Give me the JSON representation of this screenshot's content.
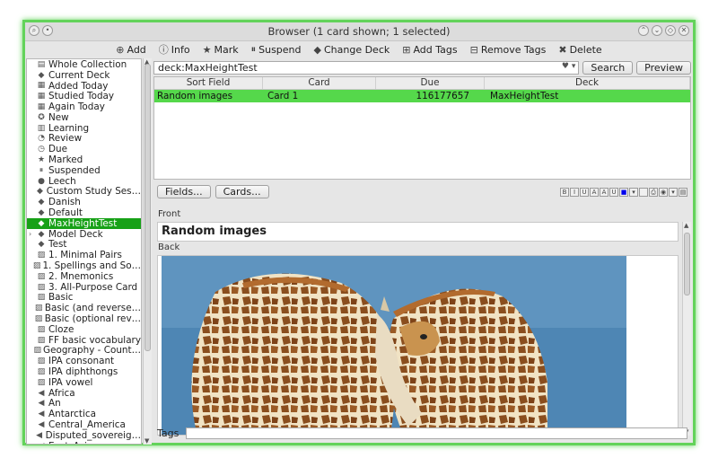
{
  "window": {
    "title": "Browser (1 card shown; 1 selected)"
  },
  "toolbar": [
    {
      "icon": "add-icon",
      "glyph": "⊕",
      "label": "Add"
    },
    {
      "icon": "info-icon",
      "glyph": "ⓘ",
      "label": "Info"
    },
    {
      "icon": "star-icon",
      "glyph": "★",
      "label": "Mark"
    },
    {
      "icon": "pause-icon",
      "glyph": "⏸",
      "label": "Suspend"
    },
    {
      "icon": "change-deck-icon",
      "glyph": "◆",
      "label": "Change Deck"
    },
    {
      "icon": "tag-icon",
      "glyph": "⊞",
      "label": "Add Tags"
    },
    {
      "icon": "remove-tag-icon",
      "glyph": "⊟",
      "label": "Remove Tags"
    },
    {
      "icon": "delete-icon",
      "glyph": "✖",
      "label": "Delete"
    }
  ],
  "sidebar": {
    "items": [
      {
        "label": "Whole Collection",
        "icon": "collection-icon",
        "glyph": "▤"
      },
      {
        "label": "Current Deck",
        "icon": "deck-icon",
        "glyph": "◆"
      },
      {
        "label": "Added Today",
        "icon": "calendar-icon",
        "glyph": "▦"
      },
      {
        "label": "Studied Today",
        "icon": "calendar-icon",
        "glyph": "▦"
      },
      {
        "label": "Again Today",
        "icon": "calendar-icon",
        "glyph": "▦"
      },
      {
        "label": "New",
        "icon": "new-icon",
        "glyph": "✪"
      },
      {
        "label": "Learning",
        "icon": "learning-icon",
        "glyph": "▥"
      },
      {
        "label": "Review",
        "icon": "review-icon",
        "glyph": "◔"
      },
      {
        "label": "Due",
        "icon": "clock-icon",
        "glyph": "◷"
      },
      {
        "label": "Marked",
        "icon": "star-icon",
        "glyph": "★"
      },
      {
        "label": "Suspended",
        "icon": "pause-icon",
        "glyph": "⏸"
      },
      {
        "label": "Leech",
        "icon": "leech-icon",
        "glyph": "●"
      },
      {
        "label": "Custom Study Ses…",
        "icon": "deck-icon",
        "glyph": "◆"
      },
      {
        "label": "Danish",
        "icon": "deck-icon",
        "glyph": "◆"
      },
      {
        "label": "Default",
        "icon": "deck-icon",
        "glyph": "◆"
      },
      {
        "label": "MaxHeightTest",
        "icon": "deck-icon",
        "glyph": "◆",
        "selected": true
      },
      {
        "label": "Model Deck",
        "icon": "deck-icon",
        "glyph": "◆",
        "expander": "›"
      },
      {
        "label": "Test",
        "icon": "deck-icon",
        "glyph": "◆"
      },
      {
        "label": "1. Minimal Pairs",
        "icon": "note-type-icon",
        "glyph": "▨"
      },
      {
        "label": "1. Spellings and So…",
        "icon": "note-type-icon",
        "glyph": "▨"
      },
      {
        "label": "2. Mnemonics",
        "icon": "note-type-icon",
        "glyph": "▨"
      },
      {
        "label": "3. All-Purpose Card",
        "icon": "note-type-icon",
        "glyph": "▨"
      },
      {
        "label": "Basic",
        "icon": "note-type-icon",
        "glyph": "▨"
      },
      {
        "label": "Basic (and reverse…",
        "icon": "note-type-icon",
        "glyph": "▨"
      },
      {
        "label": "Basic (optional rev…",
        "icon": "note-type-icon",
        "glyph": "▨"
      },
      {
        "label": "Cloze",
        "icon": "note-type-icon",
        "glyph": "▨"
      },
      {
        "label": "FF basic vocabulary",
        "icon": "note-type-icon",
        "glyph": "▨"
      },
      {
        "label": "Geography - Count…",
        "icon": "note-type-icon",
        "glyph": "▨"
      },
      {
        "label": "IPA consonant",
        "icon": "note-type-icon",
        "glyph": "▨"
      },
      {
        "label": "IPA diphthongs",
        "icon": "note-type-icon",
        "glyph": "▨"
      },
      {
        "label": "IPA vowel",
        "icon": "note-type-icon",
        "glyph": "▨"
      },
      {
        "label": "Africa",
        "icon": "tag-icon",
        "glyph": "◀"
      },
      {
        "label": "An",
        "icon": "tag-icon",
        "glyph": "◀"
      },
      {
        "label": "Antarctica",
        "icon": "tag-icon",
        "glyph": "◀"
      },
      {
        "label": "Central_America",
        "icon": "tag-icon",
        "glyph": "◀"
      },
      {
        "label": "Disputed_sovereig…",
        "icon": "tag-icon",
        "glyph": "◀"
      },
      {
        "label": "East_Asia",
        "icon": "tag-icon",
        "glyph": "◀"
      }
    ]
  },
  "search": {
    "value": "deck:MaxHeightTest",
    "search_label": "Search",
    "preview_label": "Preview"
  },
  "table": {
    "columns": [
      "Sort Field",
      "Card",
      "Due",
      "Deck"
    ],
    "rows": [
      [
        "Random images",
        "Card 1",
        "116177657",
        "MaxHeightTest"
      ]
    ]
  },
  "editor": {
    "fields_label": "Fields...",
    "cards_label": "Cards...",
    "front_label": "Front",
    "front_value": "Random images",
    "back_label": "Back",
    "tags_label": "Tags",
    "format_buttons": [
      "B",
      "I",
      "U",
      "A",
      "A",
      "U",
      "■",
      "▾",
      "",
      "⎙",
      "◉",
      "▾",
      "▤"
    ]
  },
  "colors": {
    "selection": "#17a117",
    "row_selected": "#55d84b",
    "window_border": "#63d35a",
    "sky": "#4e86b4"
  }
}
